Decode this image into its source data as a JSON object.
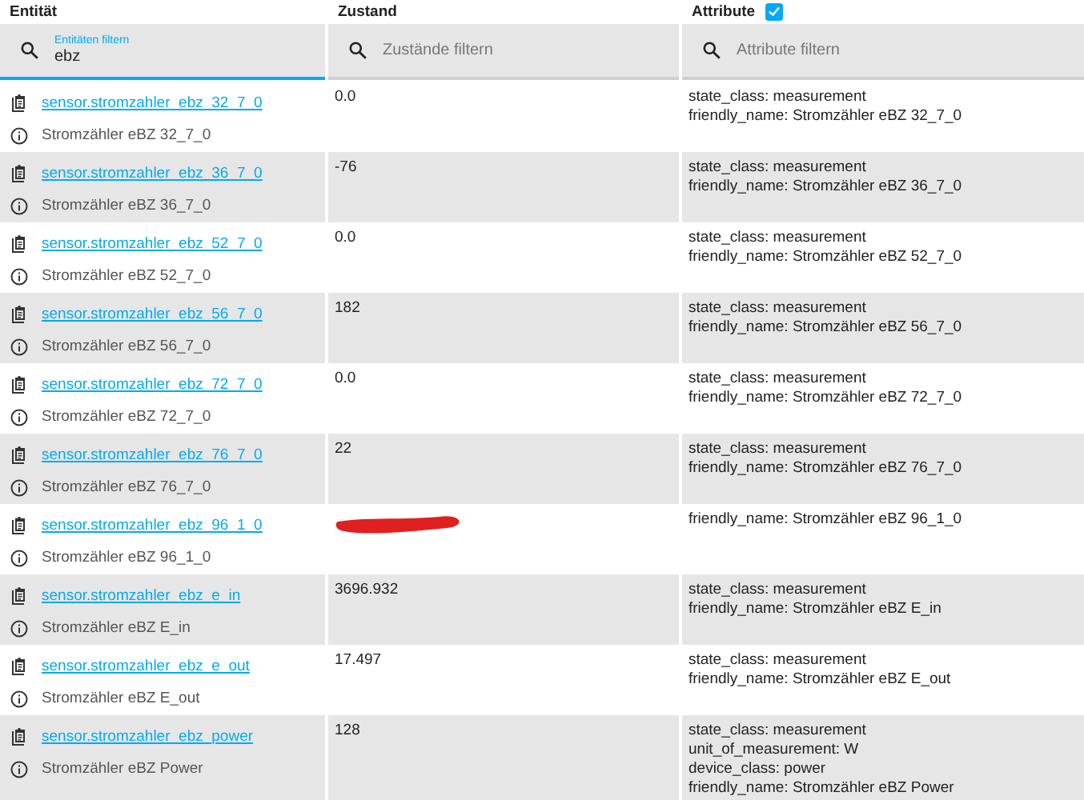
{
  "columns": [
    {
      "label": "Entität"
    },
    {
      "label": "Zustand"
    },
    {
      "label": "Attribute",
      "checkbox": {
        "checked": true
      }
    }
  ],
  "filters": [
    {
      "label": "Entitäten filtern",
      "value": "ebz",
      "focused": true
    },
    {
      "placeholder": "Zustände filtern",
      "focused": false
    },
    {
      "placeholder": "Attribute filtern",
      "focused": false
    }
  ],
  "rows": [
    {
      "entity_id": "sensor.stromzahler_ebz_32_7_0",
      "name": "Stromzähler eBZ 32_7_0",
      "state": "0.0",
      "attributes": [
        "state_class: measurement",
        "friendly_name: Stromzähler eBZ 32_7_0"
      ]
    },
    {
      "entity_id": "sensor.stromzahler_ebz_36_7_0",
      "name": "Stromzähler eBZ 36_7_0",
      "state": "-76",
      "attributes": [
        "state_class: measurement",
        "friendly_name: Stromzähler eBZ 36_7_0"
      ]
    },
    {
      "entity_id": "sensor.stromzahler_ebz_52_7_0",
      "name": "Stromzähler eBZ 52_7_0",
      "state": "0.0",
      "attributes": [
        "state_class: measurement",
        "friendly_name: Stromzähler eBZ 52_7_0"
      ]
    },
    {
      "entity_id": "sensor.stromzahler_ebz_56_7_0",
      "name": "Stromzähler eBZ 56_7_0",
      "state": "182",
      "attributes": [
        "state_class: measurement",
        "friendly_name: Stromzähler eBZ 56_7_0"
      ]
    },
    {
      "entity_id": "sensor.stromzahler_ebz_72_7_0",
      "name": "Stromzähler eBZ 72_7_0",
      "state": "0.0",
      "attributes": [
        "state_class: measurement",
        "friendly_name: Stromzähler eBZ 72_7_0"
      ]
    },
    {
      "entity_id": "sensor.stromzahler_ebz_76_7_0",
      "name": "Stromzähler eBZ 76_7_0",
      "state": "22",
      "attributes": [
        "state_class: measurement",
        "friendly_name: Stromzähler eBZ 76_7_0"
      ]
    },
    {
      "entity_id": "sensor.stromzahler_ebz_96_1_0",
      "name": "Stromzähler eBZ 96_1_0",
      "redacted": true,
      "attributes": [
        "friendly_name: Stromzähler eBZ 96_1_0"
      ]
    },
    {
      "entity_id": "sensor.stromzahler_ebz_e_in",
      "name": "Stromzähler eBZ E_in",
      "state": "3696.932",
      "attributes": [
        "state_class: measurement",
        "friendly_name: Stromzähler eBZ E_in"
      ]
    },
    {
      "entity_id": "sensor.stromzahler_ebz_e_out",
      "name": "Stromzähler eBZ E_out",
      "state": "17.497",
      "attributes": [
        "state_class: measurement",
        "friendly_name: Stromzähler eBZ E_out"
      ]
    },
    {
      "entity_id": "sensor.stromzahler_ebz_power",
      "name": "Stromzähler eBZ Power",
      "state": "128",
      "attributes": [
        "state_class: measurement",
        "unit_of_measurement: W",
        "device_class: power",
        "friendly_name: Stromzähler eBZ Power"
      ]
    }
  ]
}
